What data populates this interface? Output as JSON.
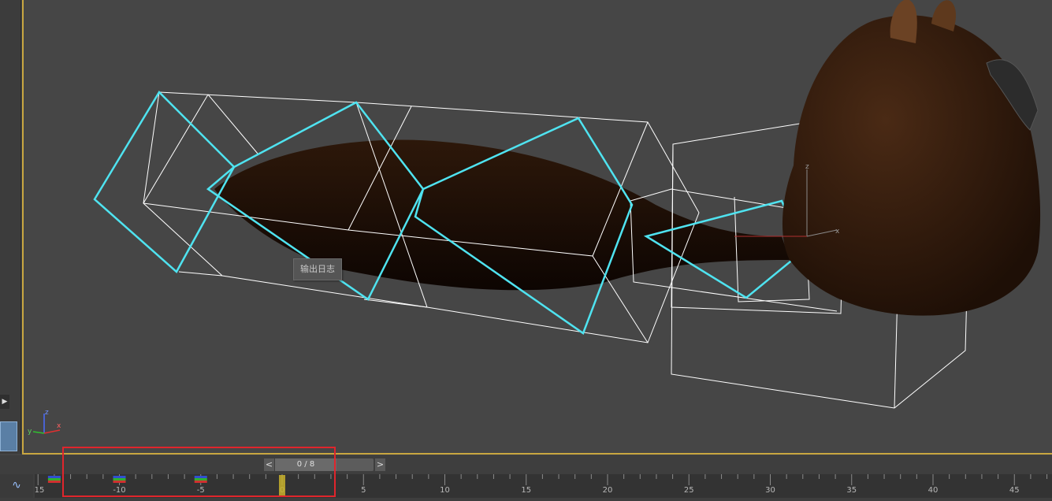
{
  "tooltip": {
    "text": "输出日志"
  },
  "frame_slider": {
    "prev_label": "<",
    "next_label": ">",
    "current_frame": "0 / 8"
  },
  "timeline": {
    "ticks": [
      "-15",
      "-10",
      "-5",
      "0",
      "5",
      "10",
      "15",
      "20",
      "25",
      "30",
      "35",
      "40",
      "45"
    ],
    "keyframes": [
      -14,
      -10,
      -5
    ],
    "current_frame": 0
  },
  "viewport": {
    "gizmo_axes": [
      "z",
      "y",
      "x"
    ],
    "border_color": "#c8a640",
    "selection_color": "#4fe3f0",
    "mesh_color": "#3d2212"
  },
  "annotation": {
    "highlight_color": "#e0252c"
  }
}
